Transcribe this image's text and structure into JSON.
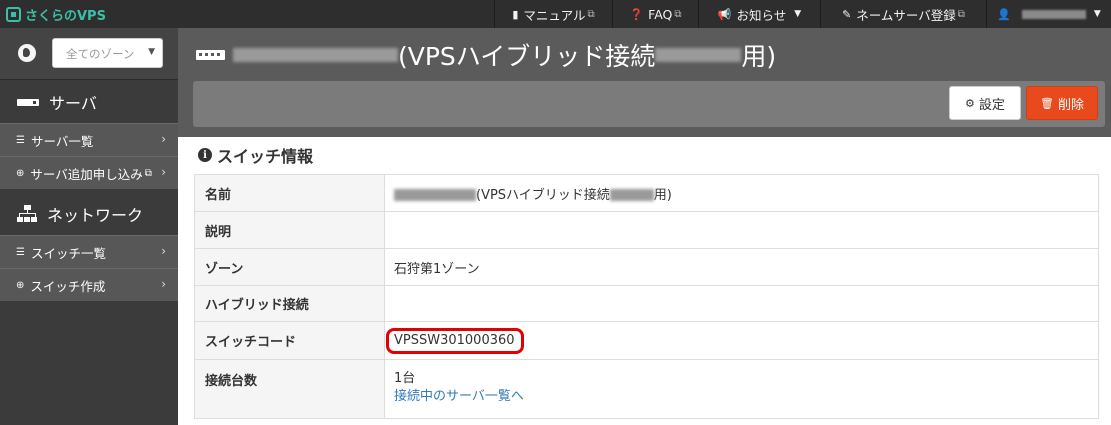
{
  "app": {
    "logo_text": "さくらのVPS"
  },
  "topnav": {
    "items": [
      {
        "label": "マニュアル",
        "icon": "book-icon"
      },
      {
        "label": "FAQ",
        "icon": "question-icon"
      },
      {
        "label": "お知らせ",
        "icon": "megaphone-icon"
      },
      {
        "label": "ネームサーバ登録",
        "icon": "edit-icon"
      }
    ],
    "user_icon": "user-icon"
  },
  "sidebar": {
    "zone_placeholder": "全てのゾーン",
    "server_heading": "サーバ",
    "server_items": [
      {
        "label": "サーバ一覧"
      },
      {
        "label": "サーバ追加申し込み"
      }
    ],
    "network_heading": "ネットワーク",
    "network_items": [
      {
        "label": "スイッチ一覧"
      },
      {
        "label": "スイッチ作成"
      }
    ]
  },
  "header": {
    "title_mid": "(VPSハイブリッド接続",
    "title_end": "用)",
    "settings_label": "設定",
    "delete_label": "削除"
  },
  "panel": {
    "title": "スイッチ情報",
    "rows": {
      "name_label": "名前",
      "name_mid": "(VPSハイブリッド接続",
      "name_end": "用)",
      "desc_label": "説明",
      "desc_value": "",
      "zone_label": "ゾーン",
      "zone_value": "石狩第1ゾーン",
      "hybrid_label": "ハイブリッド接続",
      "hybrid_value": "",
      "code_label": "スイッチコード",
      "code_value": "VPSSW301000360",
      "count_label": "接続台数",
      "count_value": "1台",
      "server_list_link": "接続中のサーバ一覧へ"
    }
  },
  "colors": {
    "accent": "#3ac0a8",
    "danger": "#e8491d",
    "link": "#337ab7",
    "highlight": "#e30000"
  }
}
